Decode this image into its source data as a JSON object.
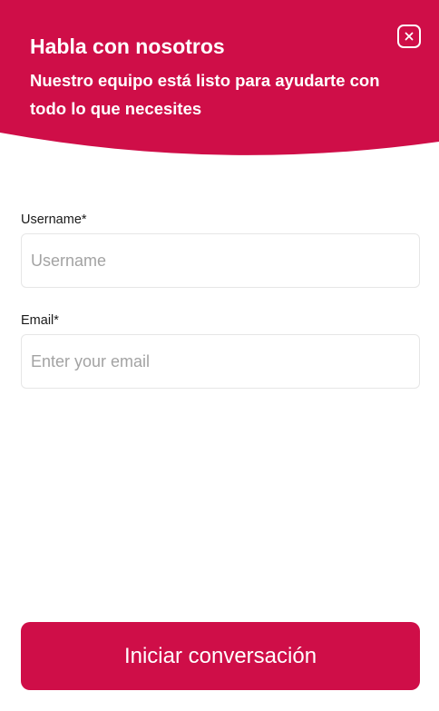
{
  "header": {
    "title": "Habla con nosotros",
    "subtitle": "Nuestro equipo está listo para ayudarte con todo lo que necesites",
    "close_icon": "close-icon",
    "background_color": "#cf0e48"
  },
  "form": {
    "username": {
      "label": "Username*",
      "placeholder": "Username",
      "value": ""
    },
    "email": {
      "label": "Email*",
      "placeholder": "Enter your email",
      "value": ""
    },
    "submit_label": "Iniciar conversación"
  },
  "colors": {
    "accent": "#cf0e48",
    "input_border": "#e6e6e6",
    "placeholder": "#a3a3a3"
  }
}
